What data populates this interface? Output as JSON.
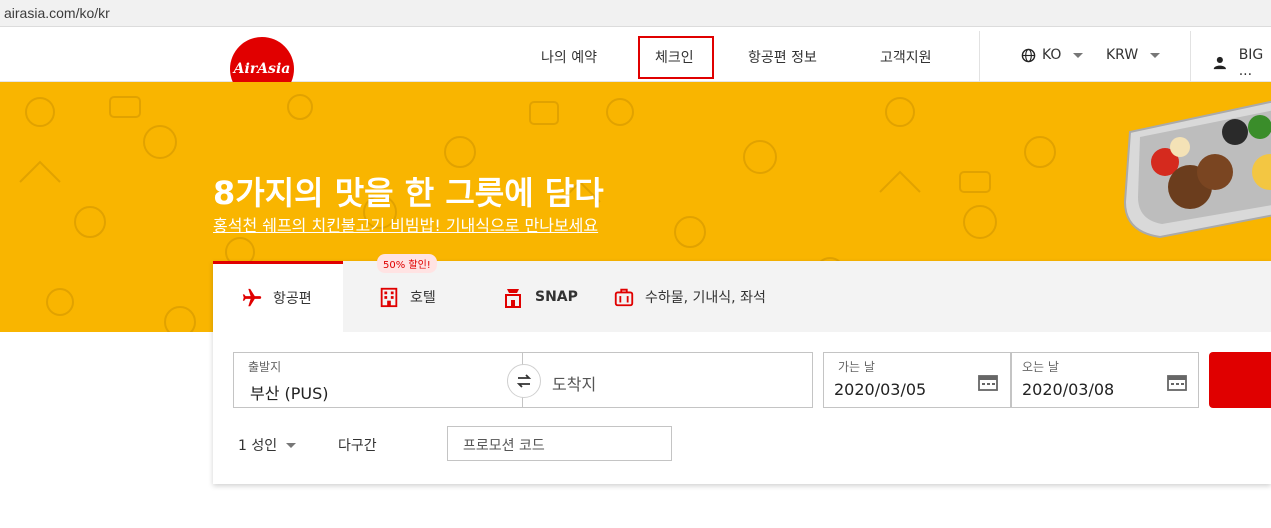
{
  "browser": {
    "url": "airasia.com/ko/kr"
  },
  "header": {
    "logo_text": "AirAsia",
    "nav": [
      {
        "label": "나의 예약"
      },
      {
        "label": "체크인"
      },
      {
        "label": "항공편 정보"
      },
      {
        "label": "고객지원"
      }
    ],
    "language": "KO",
    "currency": "KRW",
    "account": "BIG ..."
  },
  "banner": {
    "title": "8가지의 맛을 한 그릇에 담다",
    "link": "홍석천 쉐프의 치킨불고기 비빔밥! 기내식으로 만나보세요",
    "background": "#f9b500"
  },
  "search": {
    "tabs": [
      {
        "label": "항공편",
        "icon": "airplane-icon"
      },
      {
        "label": "호텔",
        "icon": "hotel-icon"
      },
      {
        "label": "SNAP",
        "icon": "snap-icon"
      },
      {
        "label": "수하물, 기내식, 좌석",
        "icon": "luggage-icon"
      }
    ],
    "hotel_badge": "50% 할인!",
    "origin": {
      "label": "출발지",
      "value": "부산 (PUS)"
    },
    "destination": {
      "placeholder": "도착지"
    },
    "depart": {
      "label": "가는 날",
      "value": "2020/03/05"
    },
    "return": {
      "label": "오는 날",
      "value": "2020/03/08"
    },
    "passengers": "1 성인",
    "multicity": "다구간",
    "promo_placeholder": "프로모션 코드",
    "accent": "#e00000"
  }
}
